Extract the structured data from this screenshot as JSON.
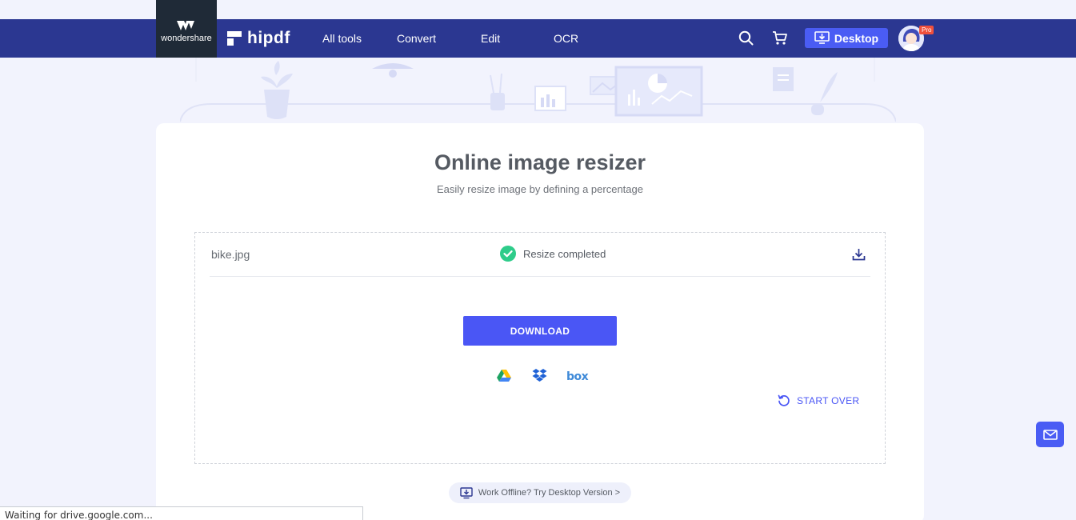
{
  "brand": {
    "parent": "wondershare",
    "product": "hipdf"
  },
  "nav": {
    "items": [
      "All tools",
      "Convert",
      "Edit",
      "OCR"
    ],
    "desktop_label": "Desktop",
    "pro_badge": "Pro"
  },
  "main": {
    "title": "Online image resizer",
    "subtitle": "Easily resize image by defining a percentage",
    "file_name": "bike.jpg",
    "status": "Resize completed",
    "download_label": "DOWNLOAD",
    "cloud_services": [
      "google-drive",
      "dropbox",
      "box"
    ],
    "box_label": "box",
    "start_over_label": "START OVER",
    "offline_label": "Work Offline? Try Desktop Version >"
  },
  "browser": {
    "status_text": "Waiting for drive.google.com..."
  },
  "colors": {
    "nav_bg": "#2b3791",
    "accent": "#4a56f5",
    "success": "#2ecc8a",
    "page_bg": "#f2f3fd"
  }
}
